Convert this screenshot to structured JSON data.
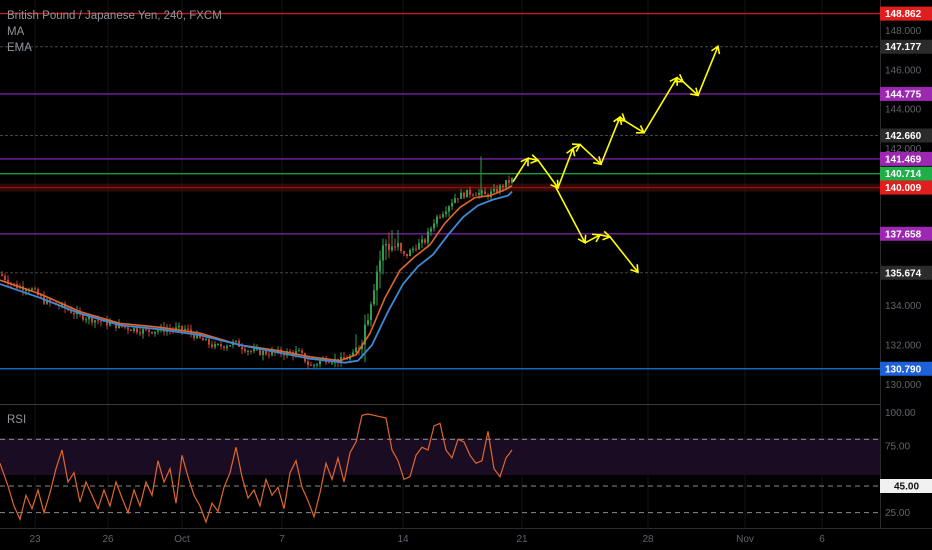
{
  "header": {
    "symbol": "British Pound / Japanese Yen, 240, FXCM",
    "indicator_1": "MA",
    "indicator_2": "EMA"
  },
  "rsi_panel": {
    "label": "RSI"
  },
  "colors": {
    "background": "#000000",
    "up_candle": "#2e9e4d",
    "down_candle": "#c8402f",
    "ma_line": "#e0672c",
    "ema_line": "#3f8ad6",
    "rsi_line": "#e0672c",
    "projection": "#ffff00"
  },
  "chart_data": [
    {
      "type": "candlestick",
      "ylim": [
        129.2,
        149.3
      ],
      "y_ticks": [
        "148.000",
        "146.000",
        "144.000",
        "142.000",
        "140.000",
        "134.000",
        "132.000",
        "130.000"
      ],
      "x_tick_labels": [
        "23",
        "26",
        "Oct",
        "7",
        "14",
        "21",
        "28",
        "Nov",
        "6"
      ],
      "series": [
        {
          "name": "MA"
        },
        {
          "name": "EMA"
        }
      ],
      "levels": [
        {
          "value": "148.862",
          "price": 148.862,
          "line": "#c21b1b",
          "badge": "#e01e1e"
        },
        {
          "value": "147.177",
          "price": 147.177,
          "line": "#444444",
          "badge": "#2b2b2b"
        },
        {
          "value": "144.775",
          "price": 144.775,
          "line": "#7b1fa2",
          "badge": "#9c27b0"
        },
        {
          "value": "142.660",
          "price": 142.66,
          "line": "#444444",
          "badge": "#2b2b2b"
        },
        {
          "value": "141.469",
          "price": 141.469,
          "line": "#7b1fa2",
          "badge": "#9c27b0"
        },
        {
          "value": "140.714",
          "price": 140.714,
          "line": "#1c9b3c",
          "badge": "#1fae47"
        },
        {
          "value": "140.009",
          "price": 140.009,
          "line": "#b71c1c",
          "badge": "#e01e1e"
        },
        {
          "value": "137.658",
          "price": 137.658,
          "line": "#7b1fa2",
          "badge": "#9c27b0"
        },
        {
          "value": "135.674",
          "price": 135.674,
          "line": "#444444",
          "badge": "#2b2b2b"
        },
        {
          "value": "130.790",
          "price": 130.79,
          "line": "#1565c0",
          "badge": "#1e60d8"
        }
      ],
      "price_path": [
        [
          0,
          135.6
        ],
        [
          15,
          135.0
        ],
        [
          30,
          134.9
        ],
        [
          45,
          134.2
        ],
        [
          60,
          134.0
        ],
        [
          80,
          133.5
        ],
        [
          100,
          133.2
        ],
        [
          125,
          132.9
        ],
        [
          145,
          132.7
        ],
        [
          165,
          132.8
        ],
        [
          185,
          132.8
        ],
        [
          200,
          132.3
        ],
        [
          215,
          131.9
        ],
        [
          235,
          132.1
        ],
        [
          250,
          131.7
        ],
        [
          265,
          131.6
        ],
        [
          280,
          131.6
        ],
        [
          300,
          131.6
        ],
        [
          310,
          130.9
        ],
        [
          325,
          131.3
        ],
        [
          340,
          131.2
        ],
        [
          355,
          131.5
        ],
        [
          365,
          133.0
        ],
        [
          375,
          135.5
        ],
        [
          385,
          137.2
        ],
        [
          395,
          137.0
        ],
        [
          405,
          136.5
        ],
        [
          415,
          137.0
        ],
        [
          425,
          137.3
        ],
        [
          435,
          138.4
        ],
        [
          445,
          138.9
        ],
        [
          455,
          139.5
        ],
        [
          465,
          139.7
        ],
        [
          475,
          139.8
        ],
        [
          485,
          139.6
        ],
        [
          495,
          139.8
        ],
        [
          505,
          140.2
        ],
        [
          512,
          140.4
        ]
      ],
      "ma_path": [
        [
          0,
          135.3
        ],
        [
          40,
          134.6
        ],
        [
          80,
          133.7
        ],
        [
          120,
          133.1
        ],
        [
          160,
          132.9
        ],
        [
          200,
          132.6
        ],
        [
          240,
          132.0
        ],
        [
          280,
          131.7
        ],
        [
          310,
          131.4
        ],
        [
          340,
          131.2
        ],
        [
          356,
          131.5
        ],
        [
          370,
          132.6
        ],
        [
          385,
          134.4
        ],
        [
          400,
          135.8
        ],
        [
          415,
          136.5
        ],
        [
          430,
          137.1
        ],
        [
          445,
          138.2
        ],
        [
          460,
          139.0
        ],
        [
          475,
          139.5
        ],
        [
          490,
          139.6
        ],
        [
          505,
          139.9
        ],
        [
          512,
          140.1
        ]
      ],
      "ema_path": [
        [
          0,
          135.1
        ],
        [
          40,
          134.4
        ],
        [
          80,
          133.6
        ],
        [
          120,
          133.0
        ],
        [
          160,
          132.8
        ],
        [
          200,
          132.5
        ],
        [
          240,
          132.0
        ],
        [
          280,
          131.6
        ],
        [
          310,
          131.3
        ],
        [
          345,
          131.1
        ],
        [
          358,
          131.2
        ],
        [
          372,
          132.0
        ],
        [
          388,
          133.7
        ],
        [
          403,
          135.1
        ],
        [
          418,
          136.0
        ],
        [
          433,
          136.6
        ],
        [
          448,
          137.6
        ],
        [
          463,
          138.5
        ],
        [
          478,
          139.1
        ],
        [
          493,
          139.4
        ],
        [
          508,
          139.6
        ],
        [
          512,
          139.8
        ]
      ],
      "projection_up": [
        [
          513,
          140.3
        ],
        [
          528,
          141.5
        ],
        [
          538,
          141.4
        ],
        [
          558,
          140.0
        ],
        [
          573,
          142.0
        ],
        [
          580,
          142.2
        ],
        [
          601,
          141.2
        ],
        [
          620,
          143.6
        ],
        [
          625,
          143.4
        ],
        [
          644,
          142.8
        ],
        [
          677,
          145.6
        ],
        [
          683,
          145.4
        ],
        [
          698,
          144.7
        ],
        [
          718,
          147.2
        ]
      ],
      "projection_down": [
        [
          555,
          140.1
        ],
        [
          585,
          137.2
        ],
        [
          600,
          137.6
        ],
        [
          610,
          137.5
        ],
        [
          638,
          135.7
        ]
      ]
    },
    {
      "type": "line",
      "title": "RSI",
      "ylim": [
        15,
        105
      ],
      "y_ticks": [
        "100.00",
        "75.00",
        "25.00"
      ],
      "highlight_tick": "45.00",
      "bands": [
        80,
        45,
        25
      ],
      "values": [
        [
          0,
          62
        ],
        [
          8,
          45
        ],
        [
          14,
          30
        ],
        [
          20,
          20
        ],
        [
          26,
          38
        ],
        [
          32,
          28
        ],
        [
          38,
          42
        ],
        [
          44,
          25
        ],
        [
          50,
          40
        ],
        [
          56,
          58
        ],
        [
          62,
          72
        ],
        [
          68,
          48
        ],
        [
          74,
          55
        ],
        [
          80,
          33
        ],
        [
          86,
          48
        ],
        [
          92,
          38
        ],
        [
          98,
          28
        ],
        [
          104,
          42
        ],
        [
          110,
          30
        ],
        [
          116,
          48
        ],
        [
          122,
          36
        ],
        [
          128,
          25
        ],
        [
          134,
          42
        ],
        [
          140,
          30
        ],
        [
          146,
          48
        ],
        [
          152,
          38
        ],
        [
          158,
          64
        ],
        [
          164,
          48
        ],
        [
          170,
          58
        ],
        [
          176,
          32
        ],
        [
          182,
          68
        ],
        [
          188,
          52
        ],
        [
          194,
          38
        ],
        [
          200,
          30
        ],
        [
          206,
          18
        ],
        [
          212,
          32
        ],
        [
          218,
          26
        ],
        [
          224,
          44
        ],
        [
          230,
          55
        ],
        [
          236,
          74
        ],
        [
          242,
          52
        ],
        [
          248,
          36
        ],
        [
          254,
          42
        ],
        [
          260,
          30
        ],
        [
          266,
          50
        ],
        [
          272,
          38
        ],
        [
          278,
          44
        ],
        [
          284,
          28
        ],
        [
          290,
          55
        ],
        [
          296,
          64
        ],
        [
          302,
          44
        ],
        [
          308,
          34
        ],
        [
          314,
          22
        ],
        [
          320,
          40
        ],
        [
          326,
          62
        ],
        [
          332,
          50
        ],
        [
          338,
          66
        ],
        [
          344,
          48
        ],
        [
          350,
          70
        ],
        [
          356,
          78
        ],
        [
          362,
          98
        ],
        [
          368,
          99
        ],
        [
          374,
          98
        ],
        [
          380,
          97
        ],
        [
          386,
          96
        ],
        [
          392,
          72
        ],
        [
          398,
          64
        ],
        [
          404,
          50
        ],
        [
          410,
          52
        ],
        [
          416,
          68
        ],
        [
          422,
          74
        ],
        [
          428,
          72
        ],
        [
          434,
          90
        ],
        [
          440,
          92
        ],
        [
          446,
          72
        ],
        [
          452,
          66
        ],
        [
          458,
          80
        ],
        [
          464,
          78
        ],
        [
          470,
          68
        ],
        [
          476,
          62
        ],
        [
          482,
          64
        ],
        [
          488,
          86
        ],
        [
          494,
          58
        ],
        [
          500,
          52
        ],
        [
          506,
          66
        ],
        [
          512,
          72
        ]
      ]
    }
  ]
}
